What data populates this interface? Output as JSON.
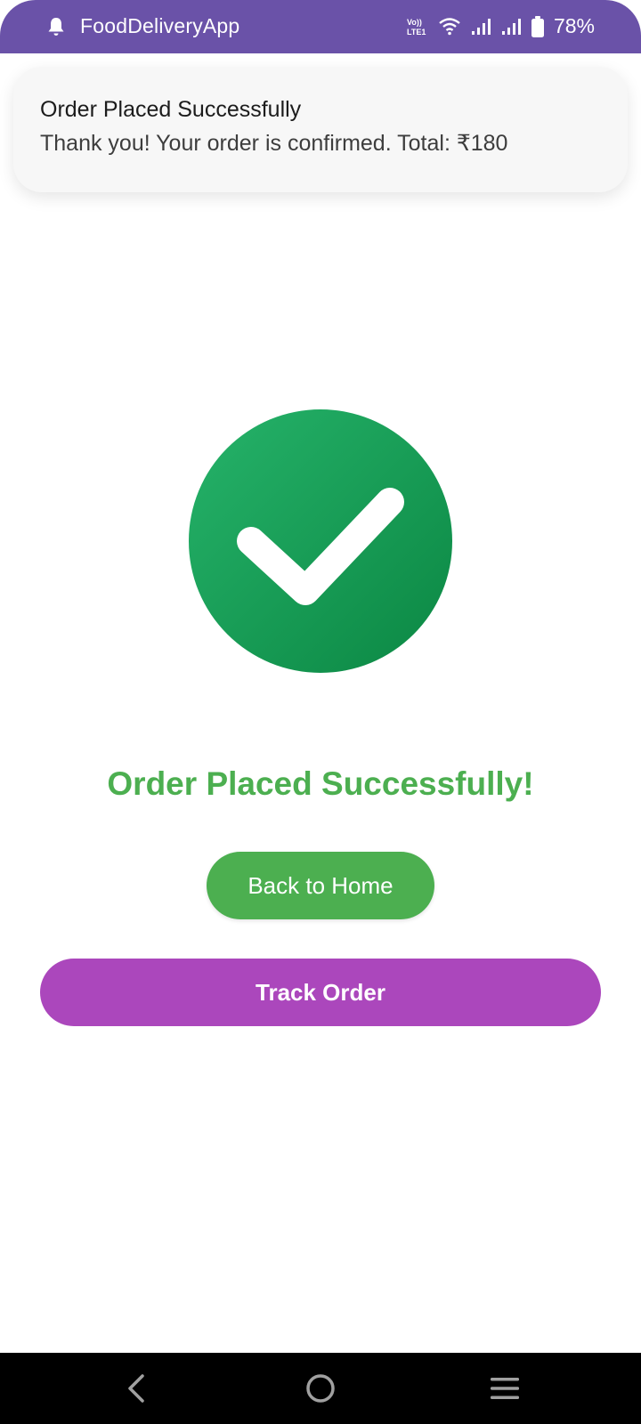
{
  "status_bar": {
    "app_name": "FoodDeliveryApp",
    "network_label": "VoLTE1",
    "battery_percent": "78%",
    "icons": [
      "notification-bell-icon",
      "volte-icon",
      "wifi-icon",
      "signal-icon",
      "signal-icon",
      "battery-icon"
    ]
  },
  "notification": {
    "title": "Order Placed Successfully",
    "body": "Thank you! Your order is confirmed. Total: ₹180"
  },
  "main": {
    "icon": "success-check-icon",
    "success_message": "Order Placed Successfully!",
    "back_home_label": "Back to Home",
    "track_order_label": "Track Order"
  },
  "nav_bar": {
    "buttons": [
      "back-icon",
      "home-icon",
      "menu-icon"
    ]
  },
  "colors": {
    "status_bar": "#6a52a8",
    "success_green": "#4caf50",
    "icon_green": "#1a9f55",
    "track_purple": "#ab47bc",
    "nav_bar": "#000000"
  }
}
